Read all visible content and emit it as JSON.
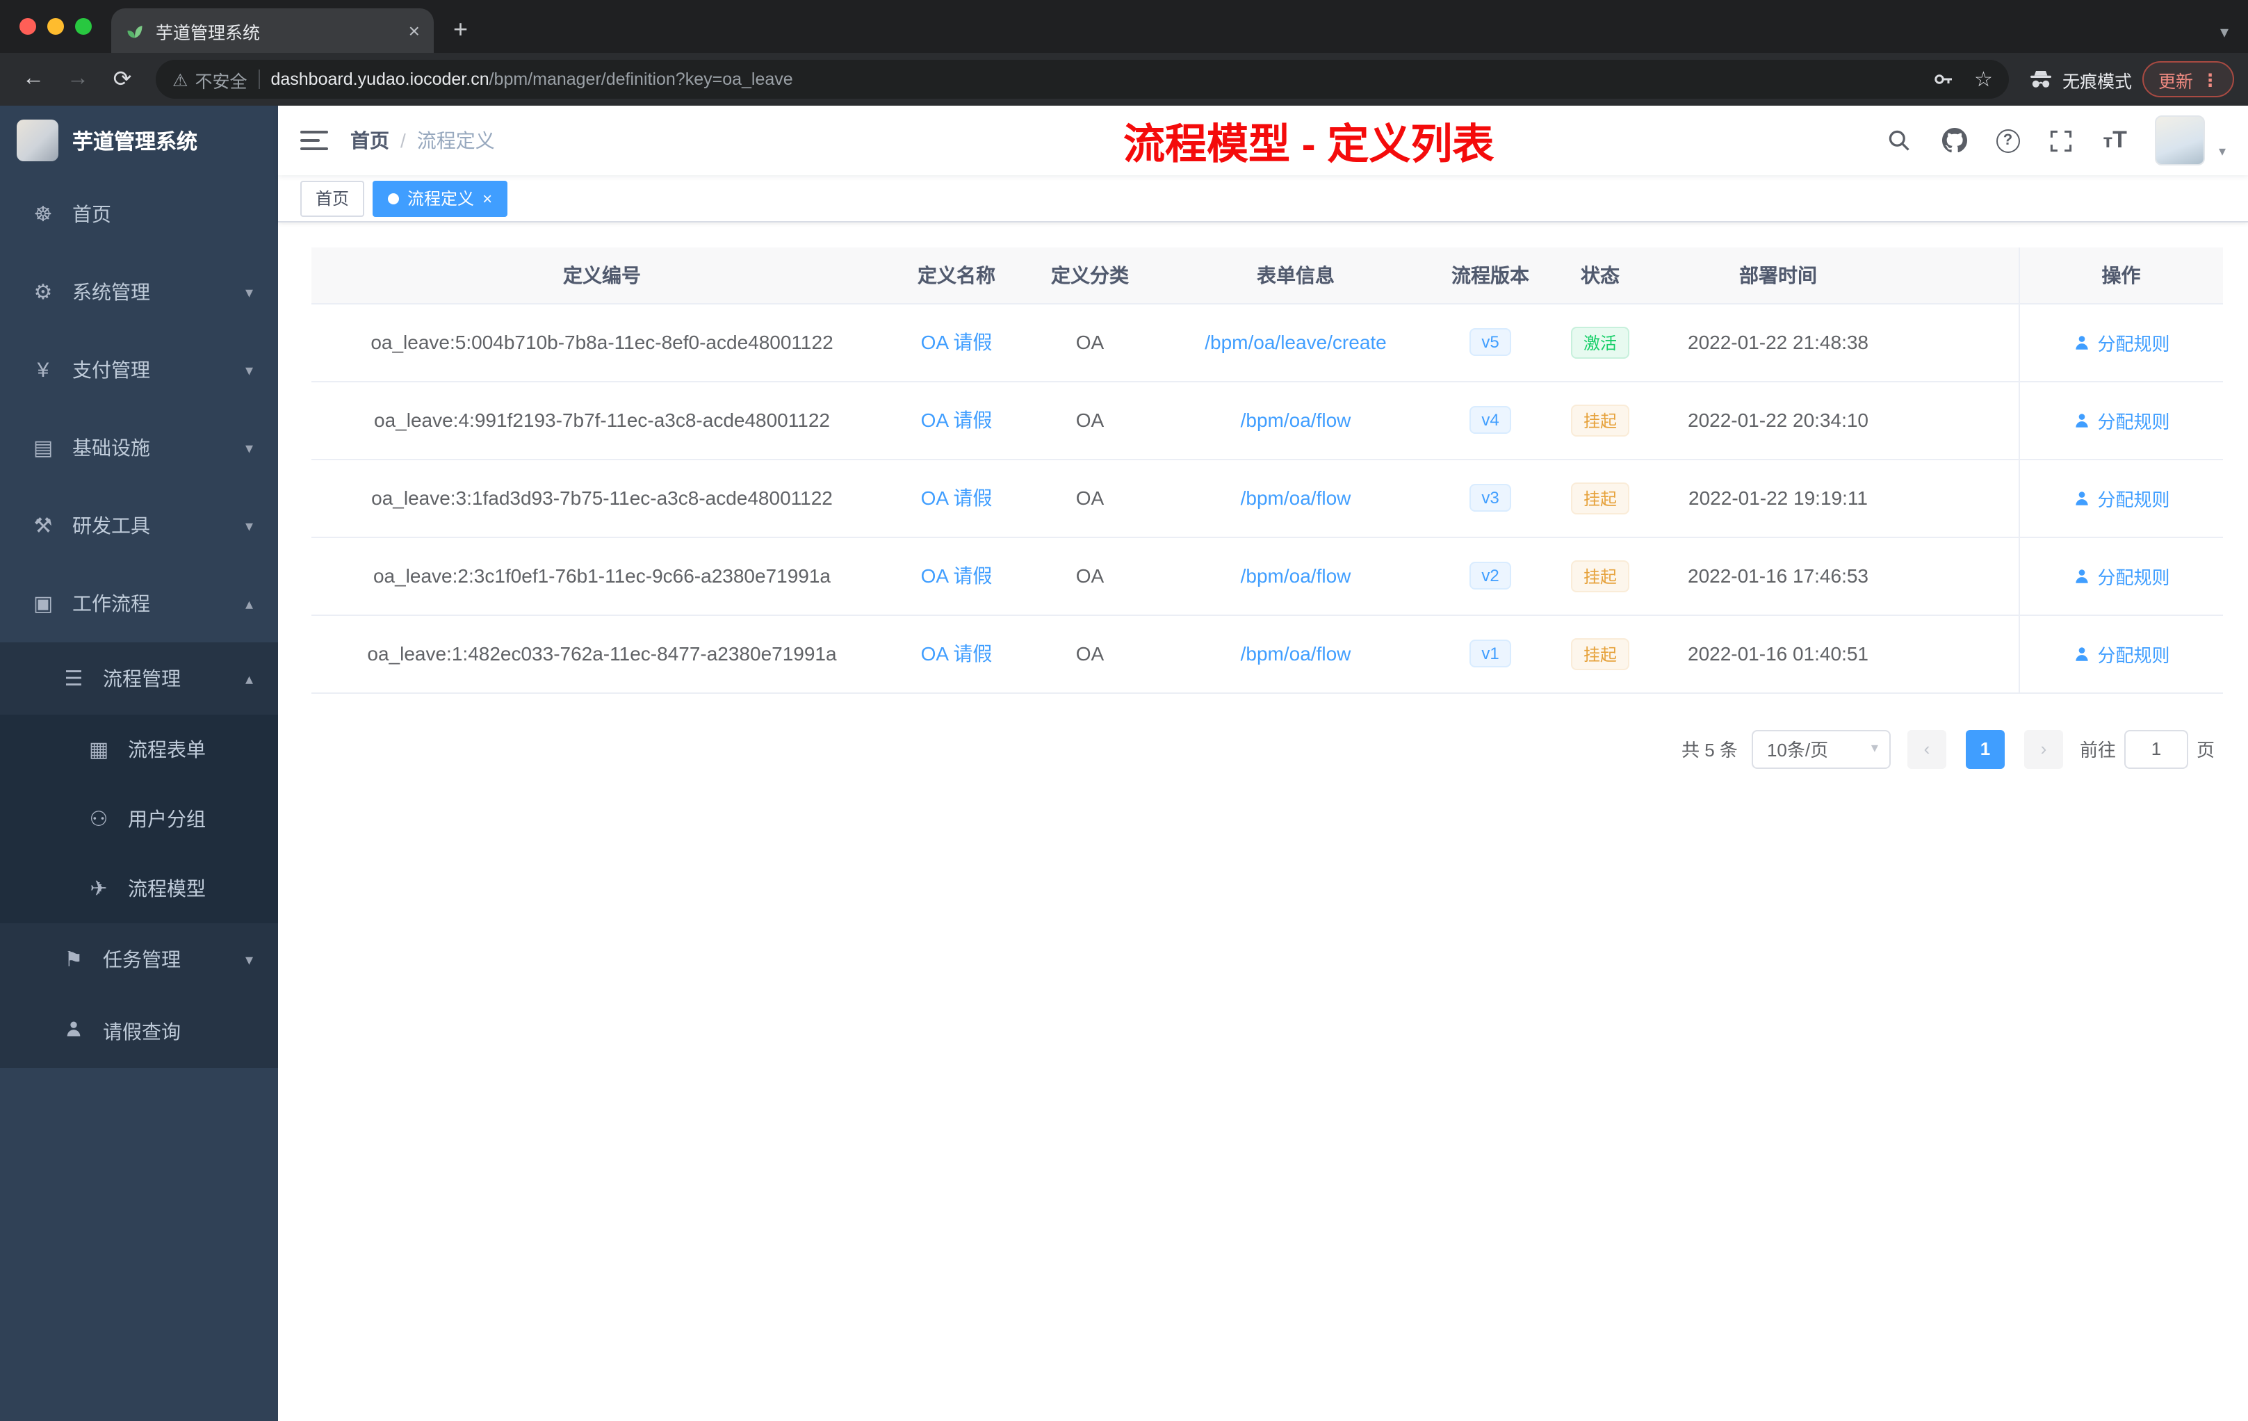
{
  "browser": {
    "tab_title": "芋道管理系统",
    "new_tab": "+",
    "security_label": "不安全",
    "url_host": "dashboard.yudao.iocoder.cn",
    "url_path": "/bpm/manager/definition?key=oa_leave",
    "incognito_label": "无痕模式",
    "update_label": "更新"
  },
  "sidebar": {
    "logo_title": "芋道管理系统",
    "items": [
      {
        "label": "首页",
        "glyph": "☸",
        "chevron": ""
      },
      {
        "label": "系统管理",
        "glyph": "⚙",
        "chevron": "▾"
      },
      {
        "label": "支付管理",
        "glyph": "¥",
        "chevron": "▾"
      },
      {
        "label": "基础设施",
        "glyph": "▤",
        "chevron": "▾"
      },
      {
        "label": "研发工具",
        "glyph": "⚒",
        "chevron": "▾"
      },
      {
        "label": "工作流程",
        "glyph": "▣",
        "chevron": "▴"
      },
      {
        "label": "流程管理",
        "glyph": "☰",
        "chevron": "▴"
      },
      {
        "label": "流程表单",
        "glyph": "▦",
        "chevron": ""
      },
      {
        "label": "用户分组",
        "glyph": "⚇",
        "chevron": ""
      },
      {
        "label": "流程模型",
        "glyph": "✈",
        "chevron": ""
      },
      {
        "label": "任务管理",
        "glyph": "⚑",
        "chevron": "▾"
      },
      {
        "label": "请假查询",
        "glyph": "",
        "chevron": ""
      }
    ]
  },
  "topbar": {
    "breadcrumb_home": "首页",
    "breadcrumb_sep": "/",
    "breadcrumb_current": "流程定义",
    "annotation": "流程模型 - 定义列表"
  },
  "tags": {
    "home": "首页",
    "active": "流程定义",
    "close": "×"
  },
  "table": {
    "headers": [
      "定义编号",
      "定义名称",
      "定义分类",
      "表单信息",
      "流程版本",
      "状态",
      "部署时间",
      "操作"
    ],
    "rows": [
      {
        "id": "oa_leave:5:004b710b-7b8a-11ec-8ef0-acde48001122",
        "name": "OA 请假",
        "category": "OA",
        "form": "/bpm/oa/leave/create",
        "version": "v5",
        "status": "激活",
        "status_type": "success",
        "time": "2022-01-22 21:48:38",
        "action": "分配规则"
      },
      {
        "id": "oa_leave:4:991f2193-7b7f-11ec-a3c8-acde48001122",
        "name": "OA 请假",
        "category": "OA",
        "form": "/bpm/oa/flow",
        "version": "v4",
        "status": "挂起",
        "status_type": "warning",
        "time": "2022-01-22 20:34:10",
        "action": "分配规则"
      },
      {
        "id": "oa_leave:3:1fad3d93-7b75-11ec-a3c8-acde48001122",
        "name": "OA 请假",
        "category": "OA",
        "form": "/bpm/oa/flow",
        "version": "v3",
        "status": "挂起",
        "status_type": "warning",
        "time": "2022-01-22 19:19:11",
        "action": "分配规则"
      },
      {
        "id": "oa_leave:2:3c1f0ef1-76b1-11ec-9c66-a2380e71991a",
        "name": "OA 请假",
        "category": "OA",
        "form": "/bpm/oa/flow",
        "version": "v2",
        "status": "挂起",
        "status_type": "warning",
        "time": "2022-01-16 17:46:53",
        "action": "分配规则"
      },
      {
        "id": "oa_leave:1:482ec033-762a-11ec-8477-a2380e71991a",
        "name": "OA 请假",
        "category": "OA",
        "form": "/bpm/oa/flow",
        "version": "v1",
        "status": "挂起",
        "status_type": "warning",
        "time": "2022-01-16 01:40:51",
        "action": "分配规则"
      }
    ]
  },
  "pagination": {
    "total": "共 5 条",
    "page_size": "10条/页",
    "prev": "‹",
    "page": "1",
    "next": "›",
    "goto_label": "前往",
    "goto_value": "1",
    "goto_unit": "页"
  }
}
